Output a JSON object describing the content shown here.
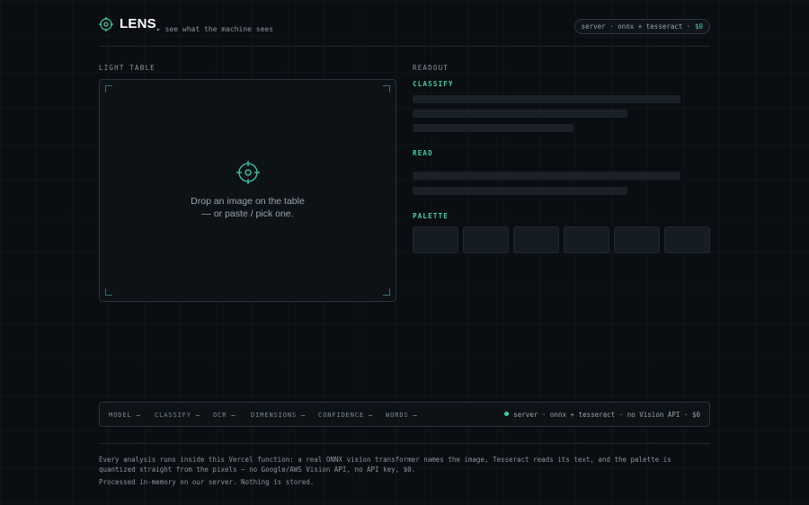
{
  "header": {
    "title": "LENS",
    "tagline": "▸ see what the machine sees",
    "server_pill_prefix": "server · onnx + tesseract · ",
    "server_pill_cost": "$0"
  },
  "light_table": {
    "label": "LIGHT TABLE",
    "drop_line1": "Drop an image on the table",
    "drop_line2": "— or paste / pick one."
  },
  "readout": {
    "label": "READOUT",
    "classify_label": "CLASSIFY",
    "read_label": "READ",
    "palette_label": "PALETTE"
  },
  "statusbar": {
    "items": [
      {
        "label": "MODEL",
        "value": "—"
      },
      {
        "label": "CLASSIFY",
        "value": "—"
      },
      {
        "label": "OCR",
        "value": "—"
      },
      {
        "label": "DIMENSIONS",
        "value": "—"
      },
      {
        "label": "CONFIDENCE",
        "value": "—"
      },
      {
        "label": "WORDS",
        "value": "—"
      }
    ],
    "server_status": "server · onnx + tesseract · no Vision API · $0"
  },
  "footer": {
    "line1": "Every analysis runs inside this Vercel function: a real ONNX vision transformer names the image, Tesseract reads its text, and the palette is quantized straight from the pixels — no Google/AWS Vision API, no API key, $0.",
    "line2": "Processed in-memory on our server. Nothing is stored."
  },
  "colors": {
    "accent": "#3fd0a8",
    "background": "#0a0d11"
  }
}
